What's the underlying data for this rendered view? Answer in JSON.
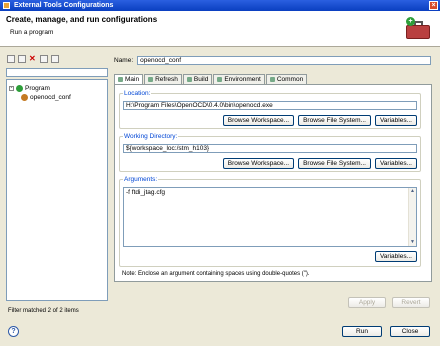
{
  "window": {
    "title": "External Tools Configurations",
    "close_glyph": "×"
  },
  "header": {
    "title": "Create, manage, and run configurations",
    "subtitle": "Run a program"
  },
  "left": {
    "filter_value": "",
    "tree": [
      {
        "label": "Program",
        "expand_glyph": "-"
      },
      {
        "label": "openocd_conf"
      }
    ],
    "status": "Filter matched 2 of 2 items"
  },
  "right": {
    "name_label": "Name:",
    "name_value": "openocd_conf",
    "tabs": [
      "Main",
      "Refresh",
      "Build",
      "Environment",
      "Common"
    ],
    "location": {
      "label": "Location:",
      "value": "H:\\Program Files\\OpenOCD\\0.4.0\\bin\\openocd.exe",
      "buttons": [
        "Browse Workspace...",
        "Browse File System...",
        "Variables..."
      ]
    },
    "working_dir": {
      "label": "Working Directory:",
      "value": "${workspace_loc:/stm_h103}",
      "buttons": [
        "Browse Workspace...",
        "Browse File System...",
        "Variables..."
      ]
    },
    "arguments": {
      "label": "Arguments:",
      "value": "-f ftdi_jtag.cfg",
      "button": "Variables...",
      "scroll_up": "▲",
      "scroll_down": "▼"
    },
    "note": "Note: Enclose an argument containing spaces using double-quotes (\").",
    "apply": "Apply",
    "revert": "Revert"
  },
  "footer": {
    "help": "?",
    "run": "Run",
    "close": "Close"
  },
  "colors": {
    "title_bar": "#0a3fc0",
    "link_blue": "#0046d5"
  }
}
